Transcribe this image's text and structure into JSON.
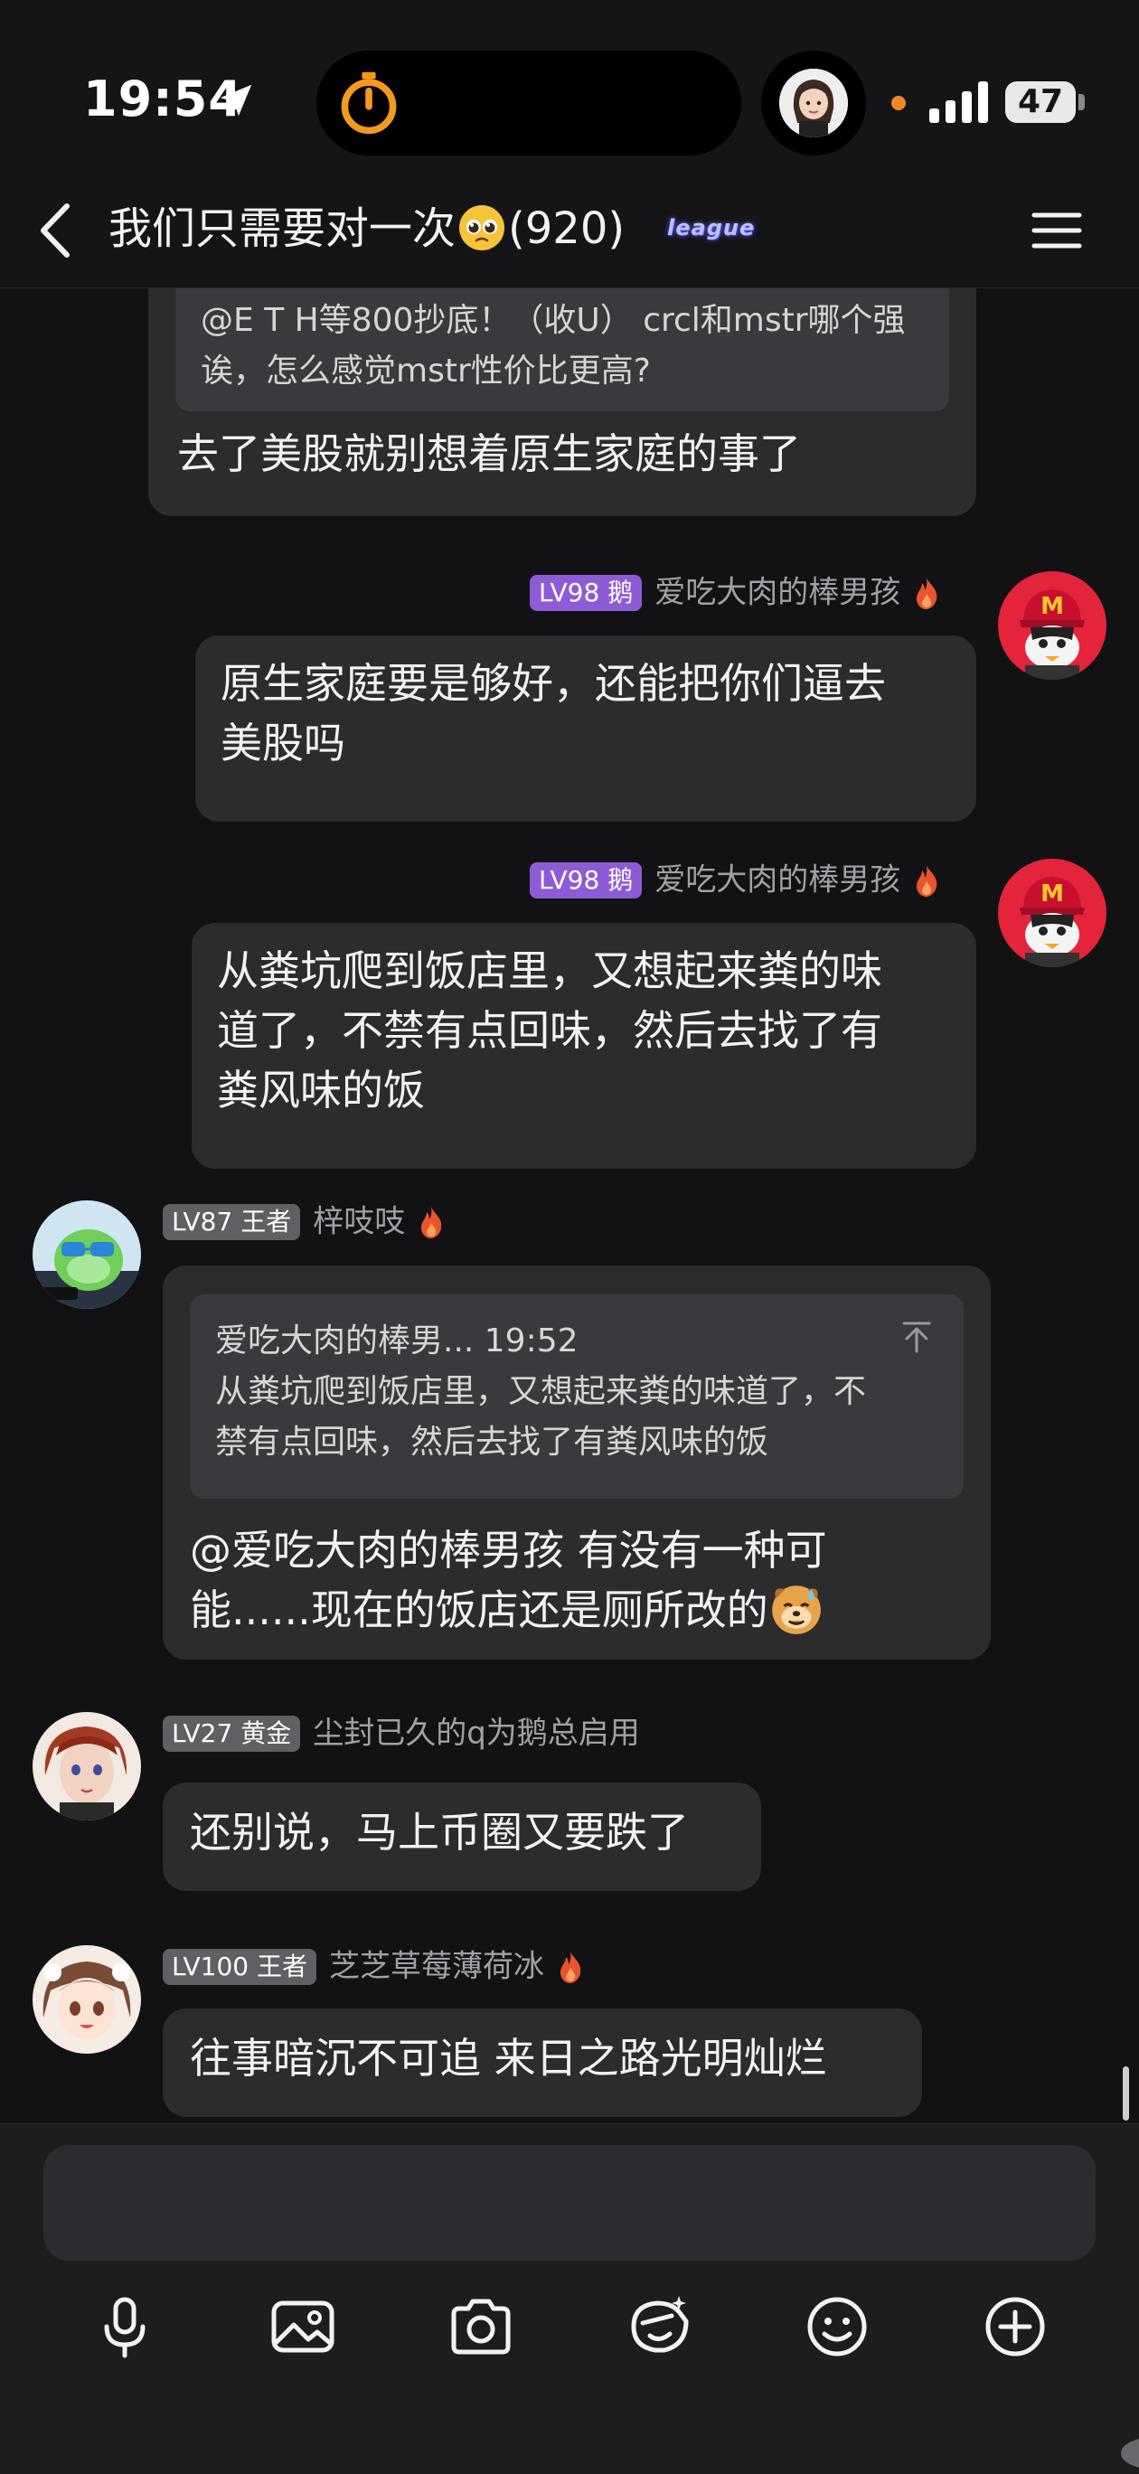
{
  "status_bar": {
    "time": "19:54",
    "battery": "47"
  },
  "header": {
    "title": "我们只需要对一次",
    "member_count": "(920)",
    "badge": "league"
  },
  "messages": [
    {
      "side": "left",
      "quote": "@E T H等800抄底！（收U） crcl和mstr哪个强诶，怎么感觉mstr性价比更高?",
      "text": "去了美股就别想着原生家庭的事了"
    },
    {
      "side": "right",
      "level": "LV98 鹅",
      "sender": "爱吃大肉的棒男孩",
      "lines": [
        "原生家庭要是够好，还能把你们逼去",
        "美股吗"
      ]
    },
    {
      "side": "right",
      "level": "LV98 鹅",
      "sender": "爱吃大肉的棒男孩",
      "lines": [
        "从粪坑爬到饭店里，又想起来粪的味",
        "道了，不禁有点回味，然后去找了有",
        "粪风味的饭"
      ]
    },
    {
      "side": "left",
      "level": "LV87 王者",
      "sender": "梓吱吱",
      "quote_header": "爱吃大肉的棒男... 19:52",
      "quote_lines": [
        "从粪坑爬到饭店里，又想起来粪的味道了，不",
        "禁有点回味，然后去找了有粪风味的饭"
      ],
      "lines": [
        "@爱吃大肉的棒男孩 有没有一种可",
        "能......现在的饭店还是厕所改的"
      ]
    },
    {
      "side": "left",
      "level": "LV27 黄金",
      "sender": "尘封已久的q为鹅总启用",
      "text": "还别说，马上币圈又要跌了"
    },
    {
      "side": "left",
      "level": "LV100 王者",
      "sender": "芝芝草莓薄荷冰",
      "text": "往事暗沉不可追  来日之路光明灿烂"
    }
  ],
  "input": {
    "placeholder": ""
  },
  "toolbar": [
    "microphone-icon",
    "image-icon",
    "camera-icon",
    "sticker-icon",
    "emoji-icon",
    "plus-icon"
  ],
  "colors": {
    "background": "#121214",
    "bubble": "#2c2c2f",
    "badge_purple": "#8d5bd6",
    "badge_gray": "#5f5f64",
    "flame": "#e8542e"
  }
}
